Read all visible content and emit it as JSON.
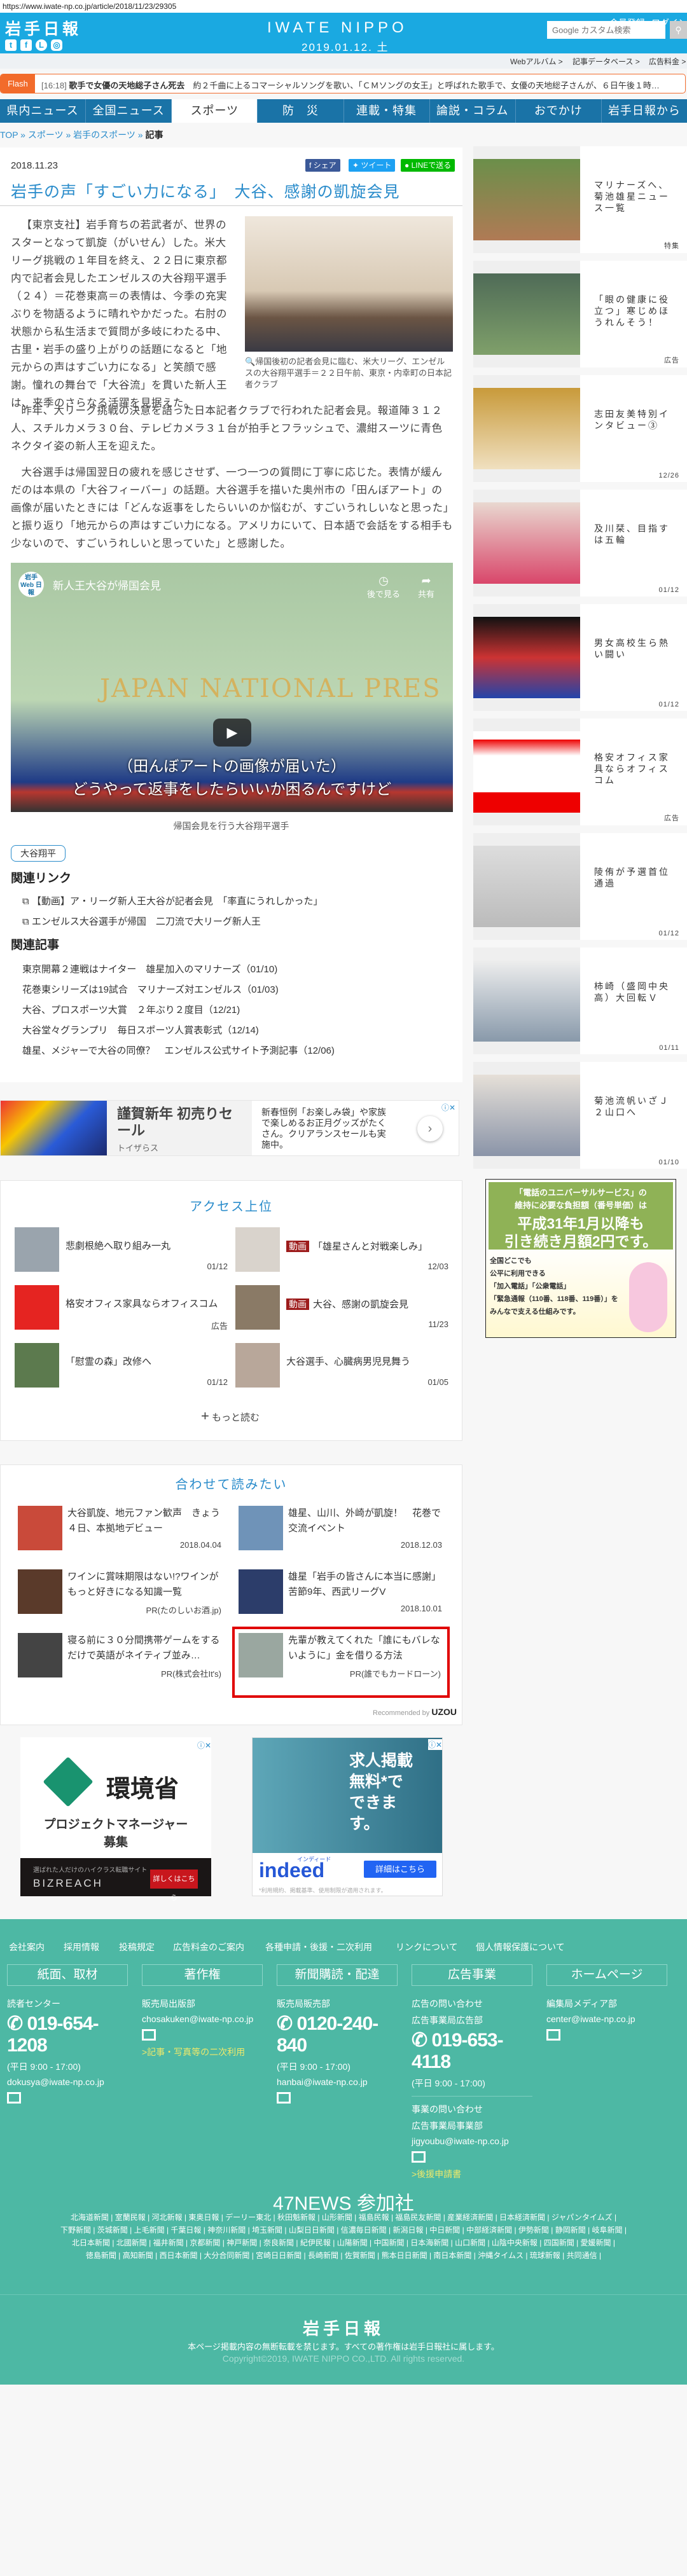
{
  "browser": {
    "url": "https://www.iwate-np.co.jp/article/2018/11/23/29305"
  },
  "header": {
    "logo": "岩手日報",
    "brand": "IWATE NIPPO",
    "date": "2019.01.12. 土",
    "member": "会員登録",
    "login": "ログイン",
    "search_placeholder": "Google カスタム検索",
    "sns": [
      "twitter-icon",
      "facebook-icon",
      "line-icon",
      "instagram-icon"
    ]
  },
  "subbar": {
    "links": [
      "Webアルバム >",
      "記事データベース >",
      "広告料金 >"
    ]
  },
  "flash": {
    "label": "Flash",
    "time": "[16:18]",
    "headline": "歌手で女優の天地総子さん死去",
    "text": "約２千曲に上るコマーシャルソングを歌い、「ＣＭソングの女王」と呼ばれた歌手で、女優の天地総子さんが、６日午後１時…"
  },
  "nav": [
    "県内ニュース",
    "全国ニュース",
    "スポーツ",
    "防　災",
    "連載・特集",
    "論説・コラム",
    "おでかけ",
    "岩手日報から"
  ],
  "breadcrumb": [
    "TOP",
    "スポーツ",
    "岩手のスポーツ",
    "記事"
  ],
  "article": {
    "date": "2018.11.23",
    "share": [
      "シェア",
      "ツイート",
      "LINEで送る"
    ],
    "title": "岩手の声「すごい力になる」　大谷、感謝の凱旋会見",
    "para1": "【東京支社】岩手育ちの若武者が、世界のスターとなって凱旋（がいせん）した。米大リーグ挑戦の１年目を終え、２２日に東京都内で記者会見したエンゼルスの大谷翔平選手（２４）＝花巻東高＝の表情は、今季の充実ぶりを物語るように晴れやかだった。右肘の状態から私生活まで質問が多岐にわたる中、古里・岩手の盛り上がりの話題になると「地元からの声はすごい力になる」と笑顔で感謝。憧れの舞台で「大谷流」を貫いた新人王は、来季のさらなる活躍を見据えた。",
    "photo_caption": "帰国後初の記者会見に臨む、米大リーグ、エンゼルスの大谷翔平選手＝２２日午前、東京・内幸町の日本記者クラブ",
    "para2": "昨年、大リーグ挑戦の決意を語った日本記者クラブで行われた記者会見。報道陣３１２人、スチルカメラ３０台、テレビカメラ３１台が拍手とフラッシュで、濃紺スーツに青色ネクタイ姿の新人王を迎えた。",
    "para3": "大谷選手は帰国翌日の疲れを感じさせず、一つ一つの質問に丁寧に応じた。表情が緩んだのは本県の「大谷フィーバー」の話題。大谷選手を描いた奥州市の「田んぼアート」の画像が届いたときには「どんな返事をしたらいいのか悩むが、すごいうれしいなと思った」と振り返り「地元からの声はすごい力になる。アメリカにいて、日本語で会話をする相手も少ないので、すごいうれしいと思っていた」と感謝した。",
    "video": {
      "channel": "岩手 Web 日報",
      "title": "新人王大谷が帰国会見",
      "watch_later": "後で見る",
      "share": "共有",
      "backdrop": "JAPAN NATIONAL PRES",
      "subtitle1": "（田んぼアートの画像が届いた）",
      "subtitle2": "どうやって返事をしたらいいか困るんですけど",
      "caption": "帰国会見を行う大谷翔平選手"
    },
    "tag": "大谷翔平",
    "related_links_title": "関連リンク",
    "related_links": [
      "【動画】ア・リーグ新人王大谷が記者会見　「率直にうれしかった」",
      "エンゼルス大谷選手が帰国　二刀流で大リーグ新人王"
    ],
    "related_articles_title": "関連記事",
    "related_articles": [
      "東京開幕２連戦はナイター　雄星加入のマリナーズ（01/10)",
      "花巻東シリーズは19試合　マリナーズ対エンゼルス（01/03)",
      "大谷、プロスポーツ大賞　２年ぶり２度目（12/21)",
      "大谷堂々グランプリ　毎日スポーツ人賞表彰式（12/14)",
      "雄星、メジャーで大谷の同僚？　エンゼルス公式サイト予測記事（12/06)"
    ]
  },
  "ad_banner": {
    "title": "謹賀新年 初売りセール",
    "advertiser": "トイザらス",
    "body": "新春恒例「お楽しみ袋」や家族で楽しめるお正月グッズがたくさん。クリアランスセールも実施中。"
  },
  "ranking": {
    "title": "アクセス上位",
    "more": "もっと読む",
    "items": [
      {
        "text": "悲劇根絶へ取り組み一丸",
        "date": "01/12",
        "badge": ""
      },
      {
        "text": "「雄星さんと対戦楽しみ」",
        "date": "12/03",
        "badge": "動画"
      },
      {
        "text": "格安オフィス家具ならオフィスコム",
        "date": "広告",
        "badge": ""
      },
      {
        "text": "大谷、感謝の凱旋会見",
        "date": "11/23",
        "badge": "動画"
      },
      {
        "text": "「慰霊の森」改修へ",
        "date": "01/12",
        "badge": ""
      },
      {
        "text": "大谷選手、心臓病男児見舞う",
        "date": "01/05",
        "badge": ""
      }
    ]
  },
  "recommend": {
    "title": "合わせて読みたい",
    "credit": "Recommended by",
    "credit_brand": "UZOU",
    "items": [
      {
        "text": "大谷凱旋、地元ファン歓声　きょう４日、本拠地デビュー",
        "meta": "2018.04.04"
      },
      {
        "text": "雄星、山川、外崎が凱旋！　花巻で交流イベント",
        "meta": "2018.12.03"
      },
      {
        "text": "ワインに賞味期限はない!?ワインがもっと好きになる知識一覧",
        "meta": "PR(たのしいお酒.jp)"
      },
      {
        "text": "雄星「岩手の皆さんに本当に感謝」　苦節9年、西武リーグV",
        "meta": "2018.10.01"
      },
      {
        "text": "寝る前に３０分間携帯ゲームをするだけで英語がネイティブ並み…",
        "meta": "PR(株式会社It's)"
      },
      {
        "text": "先輩が教えてくれた「誰にもバレないように」金を借りる方法",
        "meta": "PR(誰でもカードローン)"
      }
    ]
  },
  "ads": {
    "left": {
      "org": "環境省",
      "headline": "プロジェクトマネージャー",
      "sub": "募集",
      "tagline": "選ばれた人だけのハイクラス転職サイト",
      "brand": "BIZREACH",
      "cta": "詳しくはこちら"
    },
    "right": {
      "headline": "求人掲載 無料*で できます。",
      "brand": "indeed",
      "brand_kana": "インディード",
      "cta": "詳細はこちら",
      "note": "*利用規約、掲載基準、使用制限が適用されます。"
    }
  },
  "sidebar": {
    "items": [
      {
        "text": "マリナーズへ、菊池雄星ニュース一覧",
        "date": "特集"
      },
      {
        "text": "「眼の健康に役立つ」寒じめほうれんそう！",
        "date": "広告"
      },
      {
        "text": "志田友美特別インタビュー③",
        "date": "12/26"
      },
      {
        "text": "及川栞、目指すは五輪",
        "date": "01/12"
      },
      {
        "text": "男女高校生ら熱い闘い",
        "date": "01/12"
      },
      {
        "text": "格安オフィス家具ならオフィスコム",
        "date": "広告"
      },
      {
        "text": "陵侑が予選首位通過",
        "date": "01/12"
      },
      {
        "text": "柿崎（盛岡中央高）大回転Ｖ",
        "date": "01/11"
      },
      {
        "text": "菊池流帆いざＪ２山口へ",
        "date": "01/10"
      }
    ],
    "ad": {
      "l1": "「電話のユニバーサルサービス」の",
      "l2": "維持に必要な負担額（番号単価）は",
      "l3": "平成31年1月以降も",
      "l4": "引き続き月額2円です。",
      "b1": "全国どこでも",
      "b2": "公平に利用できる",
      "b3": "「加入電話」「公衆電話」",
      "b4": "「緊急通報（110番、118番、119番）」を",
      "b5": "みんなで支える仕組みです。"
    }
  },
  "footer": {
    "links": [
      "会社案内",
      "採用情報",
      "投稿規定",
      "広告料金のご案内",
      "各種申請・後援・二次利用",
      "リンクについて",
      "個人情報保護について"
    ],
    "cols": [
      {
        "head": "紙面、取材",
        "dept": "読者センター",
        "phone": "019-654-1208",
        "hours": "(平日 9:00 - 17:00)",
        "email": "dokusya@iwate-np.co.jp"
      },
      {
        "head": "著作権",
        "dept": "販売局出版部",
        "email": "chosakuken@iwate-np.co.jp",
        "link": ">記事・写真等の二次利用"
      },
      {
        "head": "新聞購読・配達",
        "dept": "販売局販売部",
        "phone": "0120-240-840",
        "hours": "(平日 9:00 - 17:00)",
        "email": "hanbai@iwate-np.co.jp"
      },
      {
        "head": "広告事業",
        "dept": "広告の問い合わせ",
        "dept2": "広告事業局広告部",
        "phone": "019-653-4118",
        "hours": "(平日 9:00 - 17:00)",
        "dept3": "事業の問い合わせ",
        "dept4": "広告事業局事業部",
        "email": "jigyoubu@iwate-np.co.jp",
        "link": ">後援申請書"
      },
      {
        "head": "ホームページ",
        "dept": "編集局メディア部",
        "email": "center@iwate-np.co.jp"
      }
    ],
    "news47_title": "47NEWS 参加社",
    "papers": [
      [
        "北海道新聞",
        "室蘭民報",
        "河北新報",
        "東奥日報",
        "デーリー東北",
        "秋田魁新報",
        "山形新聞",
        "福島民報",
        "福島民友新聞",
        "産業経済新聞",
        "日本経済新聞",
        "ジャパンタイムズ"
      ],
      [
        "下野新聞",
        "茨城新聞",
        "上毛新聞",
        "千葉日報",
        "神奈川新聞",
        "埼玉新聞",
        "山梨日日新聞",
        "信濃毎日新聞",
        "新潟日報",
        "中日新聞",
        "中部経済新聞",
        "伊勢新聞",
        "静岡新聞",
        "岐阜新聞"
      ],
      [
        "北日本新聞",
        "北國新聞",
        "福井新聞",
        "京都新聞",
        "神戸新聞",
        "奈良新聞",
        "紀伊民報",
        "山陽新聞",
        "中国新聞",
        "日本海新聞",
        "山口新聞",
        "山陰中央新報",
        "四国新聞",
        "愛媛新聞"
      ],
      [
        "徳島新聞",
        "高知新聞",
        "西日本新聞",
        "大分合同新聞",
        "宮崎日日新聞",
        "長崎新聞",
        "佐賀新聞",
        "熊本日日新聞",
        "南日本新聞",
        "沖縄タイムス",
        "琉球新報",
        "共同通信"
      ]
    ],
    "logo": "岩手日報",
    "notice": "本ページ掲載内容の無断転載を禁じます。すべての著作権は岩手日報社に属します。",
    "copyright": "Copyright©2019, IWATE NIPPO CO.,LTD. All rights reserved."
  },
  "colors": {
    "header": "#1aa9e1",
    "nav": "#1a73a7",
    "flash": "#f26b2b",
    "title": "#2a8ccb",
    "footer": "#4db8a4",
    "badge": "#9d1c1c",
    "highlight": "#e00000"
  }
}
